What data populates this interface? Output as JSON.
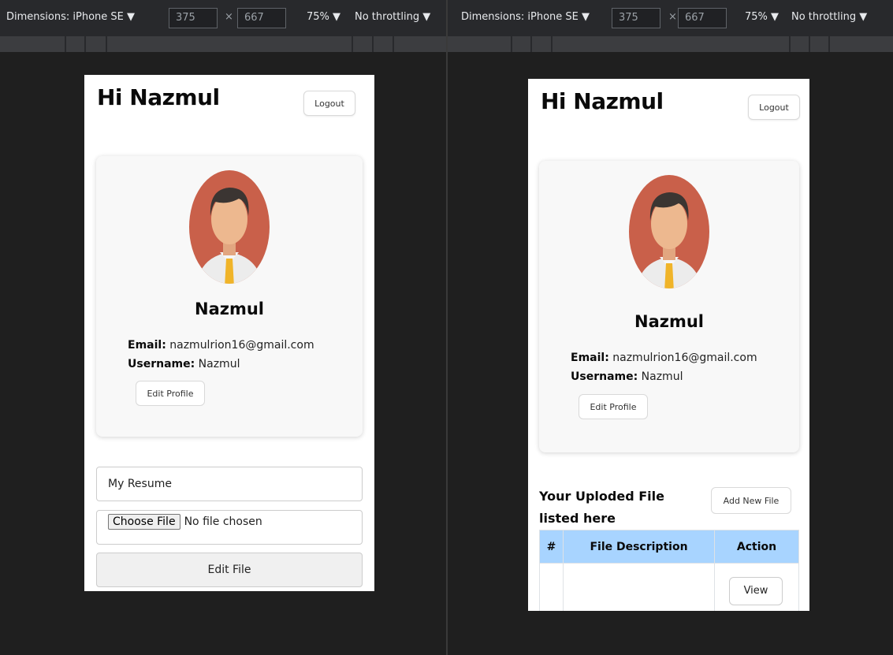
{
  "devtools": {
    "dimensions_label": "Dimensions: iPhone SE ▼",
    "width": "375",
    "height": "667",
    "times": "×",
    "zoom": "75% ▼",
    "throttling": "No throttling ▼"
  },
  "app": {
    "greeting": "Hi Nazmul",
    "logout_label": "Logout",
    "profile": {
      "name": "Nazmul",
      "email_label": "Email:",
      "email": "nazmulrion16@gmail.com",
      "username_label": "Username:",
      "username": "Nazmul",
      "edit_profile_label": "Edit Profile"
    },
    "edit_form": {
      "description_value": "My Resume",
      "choose_file_label": "Choose File",
      "no_file_text": "No file chosen",
      "submit_label": "Edit File"
    },
    "files": {
      "title": "Your Uploded File listed here",
      "add_new_label": "Add New File",
      "columns": [
        "#",
        "File Description",
        "Action"
      ],
      "view_label": "View"
    }
  },
  "colors": {
    "table_header": "#a8d4ff",
    "avatar_bg": "#c9604a",
    "tie": "#f0b429"
  },
  "icons": {
    "avatar": "man-avatar-icon"
  }
}
